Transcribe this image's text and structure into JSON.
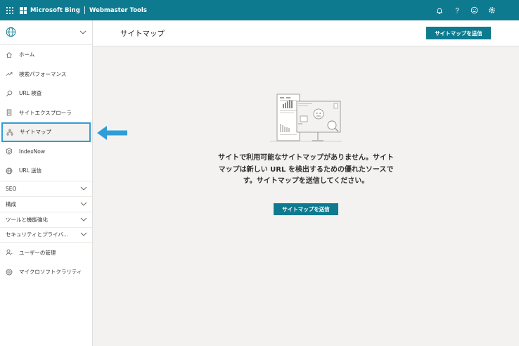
{
  "header": {
    "brand": "Microsoft Bing",
    "product": "Webmaster Tools",
    "icons": [
      "bell-icon",
      "help-icon",
      "smiley-icon",
      "gear-icon"
    ]
  },
  "sidebar": {
    "site_icon": "globe-icon",
    "items": [
      {
        "label": "ホーム",
        "icon": "home-icon"
      },
      {
        "label": "検索パフォーマンス",
        "icon": "trend-icon"
      },
      {
        "label": "URL 検査",
        "icon": "search-icon"
      },
      {
        "label": "サイトエクスプローラ",
        "icon": "document-icon"
      },
      {
        "label": "サイトマップ",
        "icon": "sitemap-icon",
        "active": true
      },
      {
        "label": "IndexNow",
        "icon": "hexagon-icon"
      },
      {
        "label": "URL 送信",
        "icon": "globe-icon"
      }
    ],
    "groups": [
      {
        "label": "SEO"
      },
      {
        "label": "構成"
      },
      {
        "label": "ツールと機能強化"
      },
      {
        "label": "セキュリティとプライバ..."
      }
    ],
    "bottom_items": [
      {
        "label": "ユーザーの管理",
        "icon": "user-icon"
      },
      {
        "label": "マイクロソフトクラリティ",
        "icon": "clarity-icon"
      }
    ]
  },
  "main": {
    "title": "サイトマップ",
    "submit_button": "サイトマップを送信",
    "empty_message_lines": [
      "サイトで利用可能なサイトマップがありません。サイト",
      "マップは新しい URL を検出するための優れたソースで",
      "す。サイトマップを送信してください。"
    ],
    "empty_button": "サイトマップを送信"
  },
  "colors": {
    "brand_teal": "#0e7a8f",
    "highlight_blue": "#2f9ed8"
  }
}
